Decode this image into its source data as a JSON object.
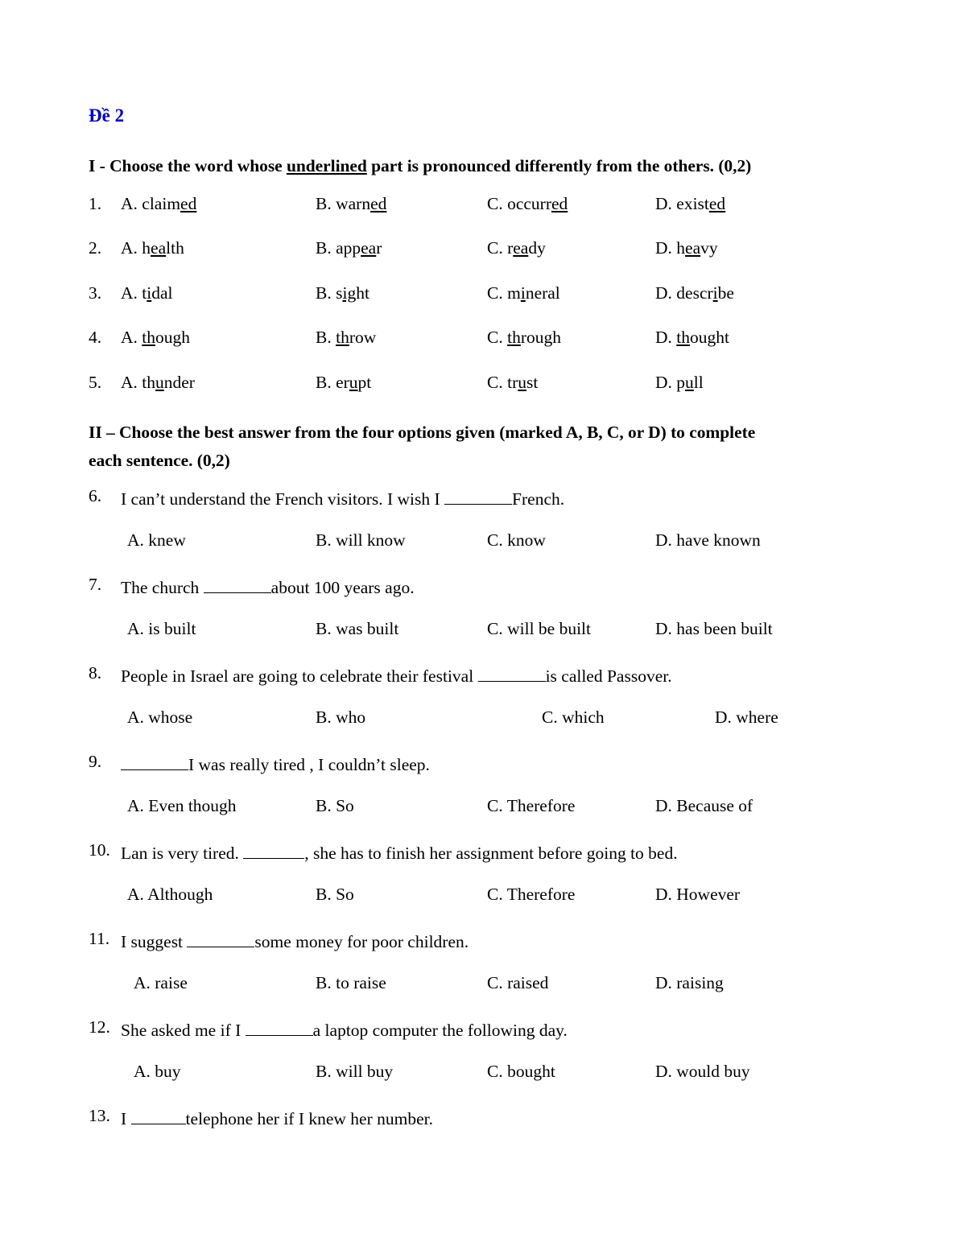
{
  "document": {
    "title": "Đề 2",
    "title_color": "#0000CC"
  },
  "section_one": {
    "heading_prefix": "I - Choose the word whose ",
    "heading_underlined": "underlined",
    "heading_suffix": " part is pronounced differently from the others. (0,2)",
    "questions": [
      {
        "number": "1.",
        "options": [
          {
            "label": "A. ",
            "pre": "claim",
            "underlined": "ed",
            "post": ""
          },
          {
            "label": "B. ",
            "pre": "warn",
            "underlined": "ed",
            "post": ""
          },
          {
            "label": "C. ",
            "pre": "occurr",
            "underlined": "ed",
            "post": ""
          },
          {
            "label": "D. ",
            "pre": "exist",
            "underlined": "ed",
            "post": ""
          }
        ]
      },
      {
        "number": "2.",
        "options": [
          {
            "label": "A. ",
            "pre": "h",
            "underlined": "ea",
            "post": "lth"
          },
          {
            "label": "B. ",
            "pre": "app",
            "underlined": "ea",
            "post": "r"
          },
          {
            "label": "C. ",
            "pre": "r",
            "underlined": "ea",
            "post": "dy"
          },
          {
            "label": "D. ",
            "pre": "h",
            "underlined": "ea",
            "post": "vy"
          }
        ]
      },
      {
        "number": "3.",
        "options": [
          {
            "label": "A. ",
            "pre": "t",
            "underlined": "i",
            "post": "dal"
          },
          {
            "label": "B. ",
            "pre": "s",
            "underlined": "ig",
            "post": "ht"
          },
          {
            "label": "C. ",
            "pre": "m",
            "underlined": "i",
            "post": "neral"
          },
          {
            "label": "D. ",
            "pre": "descr",
            "underlined": "i",
            "post": "be"
          }
        ]
      },
      {
        "number": "4.",
        "options": [
          {
            "label": "A. ",
            "pre": "",
            "underlined": "th",
            "post": "ough"
          },
          {
            "label": "B. ",
            "pre": "",
            "underlined": "th",
            "post": "row"
          },
          {
            "label": "C. ",
            "pre": "",
            "underlined": "th",
            "post": "rough"
          },
          {
            "label": "D. ",
            "pre": "",
            "underlined": "th",
            "post": "ought"
          }
        ]
      },
      {
        "number": "5.",
        "options": [
          {
            "label": "A. ",
            "pre": "th",
            "underlined": "u",
            "post": "nder"
          },
          {
            "label": "B. ",
            "pre": "er",
            "underlined": "u",
            "post": "pt"
          },
          {
            "label": "C. ",
            "pre": "tr",
            "underlined": "u",
            "post": "st"
          },
          {
            "label": "D. ",
            "pre": "p",
            "underlined": "u",
            "post": "ll"
          }
        ]
      }
    ]
  },
  "section_two": {
    "heading_line1": "II – Choose the best answer from the four options given (marked A, B, C, or D) to complete",
    "heading_line2": "each sentence. (0,2)",
    "questions": [
      {
        "number": "6.",
        "stem_before": "I can’t understand the French visitors. I wish I ",
        "stem_after": "French.",
        "options": [
          "A. knew",
          "B. will know",
          "C. know",
          "D. have known"
        ]
      },
      {
        "number": "7.",
        "stem_before": "The church ",
        "stem_after": "about 100 years ago.",
        "options": [
          "A. is built",
          "B. was built",
          "C. will be built",
          "D. has been built"
        ]
      },
      {
        "number": "8.",
        "stem_before": "People in Israel are going to celebrate their festival ",
        "stem_after": "is called Passover.",
        "options": [
          "A. whose",
          "B. who",
          "C. which",
          "D. where"
        ]
      },
      {
        "number": "9.",
        "stem_before": "",
        "stem_after": "I was really tired , I couldn’t sleep.",
        "options": [
          "A. Even though",
          "B. So",
          "C. Therefore",
          "D. Because of"
        ]
      },
      {
        "number": "10.",
        "stem_before": "Lan is very tired. ",
        "stem_after": ", she has to finish her assignment before going to bed.",
        "options": [
          "A. Although",
          "B. So",
          "C. Therefore",
          "D. However"
        ]
      },
      {
        "number": "11.",
        "stem_before": "I suggest ",
        "stem_after": "some money for poor children.",
        "options": [
          "A. raise",
          "B. to raise",
          "C. raised",
          "D. raising"
        ]
      },
      {
        "number": "12.",
        "stem_before": "She asked me if I ",
        "stem_after": "a laptop computer the following day.",
        "options": [
          "A. buy",
          "B. will buy",
          "C. bought",
          "D. would buy"
        ]
      },
      {
        "number": "13.",
        "stem_before": "I ",
        "stem_after": "telephone her if I knew her number.",
        "options": []
      }
    ]
  }
}
